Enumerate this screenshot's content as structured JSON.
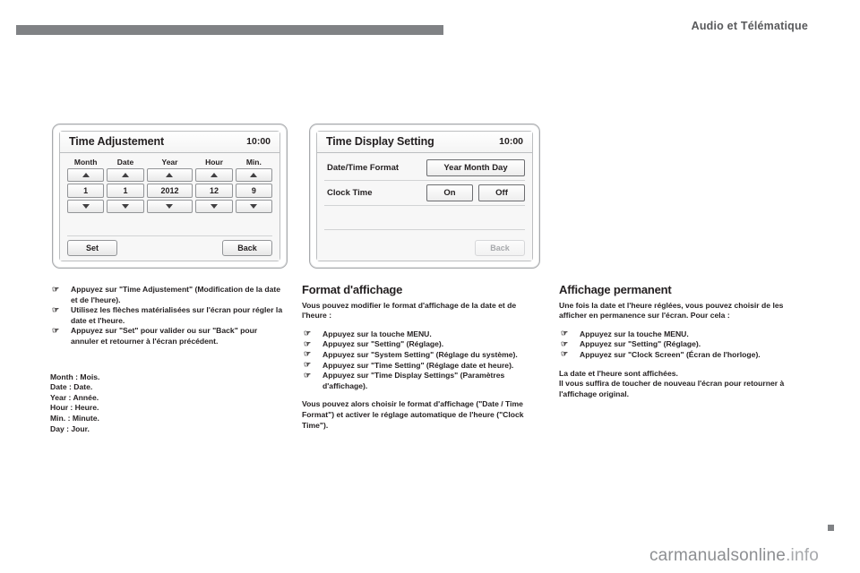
{
  "header": {
    "title": "Audio et Télématique"
  },
  "screens": {
    "time_adjustment": {
      "title": "Time Adjustement",
      "clock": "10:00",
      "columns": [
        {
          "label": "Month",
          "value": "1"
        },
        {
          "label": "Date",
          "value": "1"
        },
        {
          "label": "Year",
          "value": "2012"
        },
        {
          "label": "Hour",
          "value": "12"
        },
        {
          "label": "Min.",
          "value": "9"
        }
      ],
      "set_label": "Set",
      "back_label": "Back"
    },
    "time_display_setting": {
      "title": "Time Display Setting",
      "clock": "10:00",
      "rows": [
        {
          "label": "Date/Time Format",
          "options": [
            "Year Month Day"
          ]
        },
        {
          "label": "Clock Time",
          "options": [
            "On",
            "Off"
          ]
        }
      ],
      "back_label": "Back"
    }
  },
  "columns": {
    "left": {
      "bullets": [
        "Appuyez sur \"Time Adjustement\" (Modification de la date et de l'heure).",
        "Utilisez les flèches matérialisées sur l'écran pour régler la date et l'heure.",
        "Appuyez sur \"Set\" pour valider ou sur \"Back\" pour annuler et retourner à l'écran précédent."
      ],
      "glossary": [
        "Month : Mois.",
        "Date : Date.",
        "Year : Année.",
        "Hour : Heure.",
        "Min. : Minute.",
        "Day : Jour."
      ]
    },
    "middle": {
      "heading": "Format d'affichage",
      "intro": "Vous pouvez modifier le format d'affichage de la date et de l'heure :",
      "bullets": [
        "Appuyez sur la touche MENU.",
        "Appuyez sur \"Setting\" (Réglage).",
        "Appuyez sur \"System Setting\" (Réglage du système).",
        "Appuyez sur \"Time Setting\" (Réglage date et heure).",
        "Appuyez sur \"Time Display Settings\" (Paramètres d'affichage)."
      ],
      "outro": "Vous pouvez alors choisir le format d'affichage (\"Date / Time Format\") et activer le réglage automatique de l'heure (\"Clock Time\")."
    },
    "right": {
      "heading": "Affichage permanent",
      "intro": "Une fois la date et l'heure réglées, vous pouvez choisir de les afficher en permanence sur l'écran. Pour cela :",
      "bullets": [
        "Appuyez sur la touche MENU.",
        "Appuyez sur \"Setting\" (Réglage).",
        "Appuyez sur \"Clock Screen\" (Écran de l'horloge)."
      ],
      "outro": "La date et l'heure sont affichées.\nIl vous suffira de toucher de nouveau l'écran pour retourner à l'affichage original."
    }
  },
  "footer": {
    "watermark_main": "carmanualsonline",
    "watermark_suffix": ".info"
  },
  "icons": {
    "bullet": "☞",
    "caret_up": "caret-up-icon",
    "caret_down": "caret-down-icon"
  }
}
